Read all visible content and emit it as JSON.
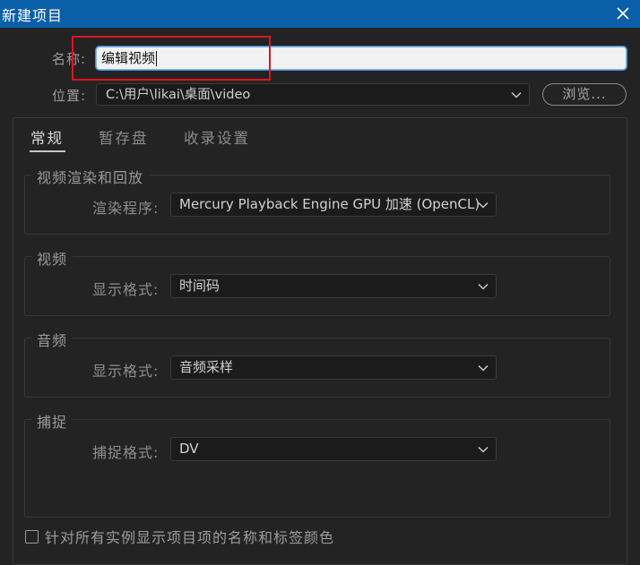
{
  "window": {
    "title": "新建项目",
    "close_icon": "close-icon"
  },
  "name_field": {
    "label": "名称:",
    "value": "编辑视频"
  },
  "location": {
    "label": "位置:",
    "value": "C:\\用户\\likai\\桌面\\video",
    "browse_label": "浏览..."
  },
  "tabs": [
    {
      "label": "常规",
      "active": true
    },
    {
      "label": "暂存盘",
      "active": false
    },
    {
      "label": "收录设置",
      "active": false
    }
  ],
  "groups": {
    "render": {
      "title": "视频渲染和回放",
      "field_label": "渲染程序:",
      "value": "Mercury Playback Engine GPU 加速 (OpenCL)"
    },
    "video": {
      "title": "视频",
      "field_label": "显示格式:",
      "value": "时间码"
    },
    "audio": {
      "title": "音频",
      "field_label": "显示格式:",
      "value": "音频采样"
    },
    "capture": {
      "title": "捕捉",
      "field_label": "捕捉格式:",
      "value": "DV"
    }
  },
  "show_labels_checkbox": {
    "label": "针对所有实例显示项目项的名称和标签颜色",
    "checked": false
  },
  "colors": {
    "titlebar": "#0b5fa8",
    "background": "#232323",
    "highlight": "#e0141e"
  }
}
